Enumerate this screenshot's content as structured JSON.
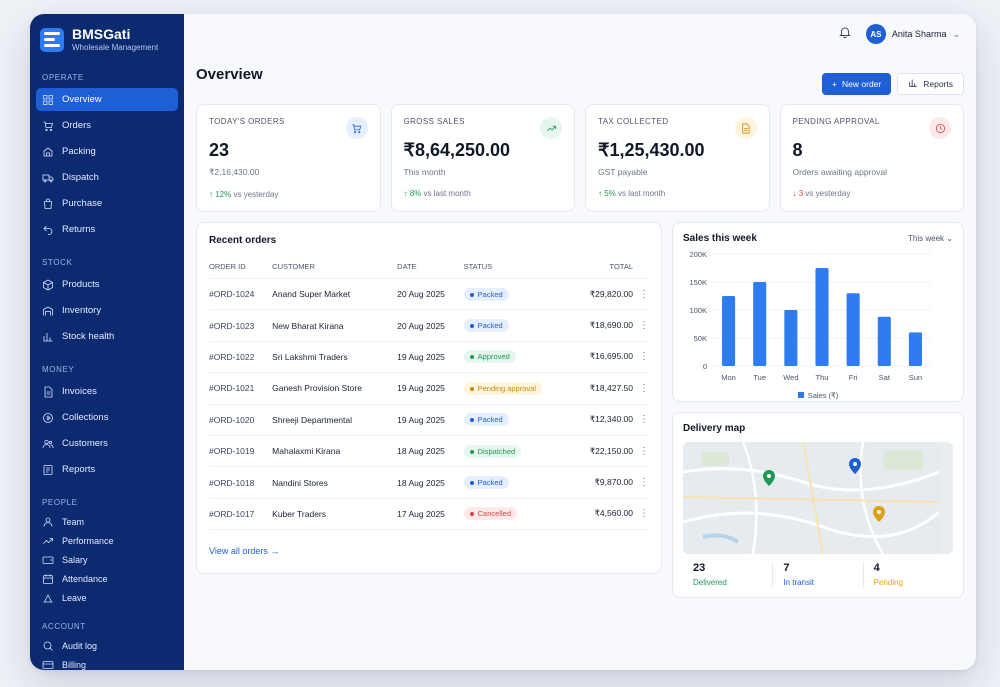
{
  "brand": {
    "name": "BMSGati",
    "subtitle": "Wholesale Management"
  },
  "sidebar": {
    "sections": [
      {
        "label": "OPERATE",
        "items": [
          {
            "label": "Overview",
            "icon": "grid-icon",
            "active": true
          },
          {
            "label": "Orders",
            "icon": "cart-icon"
          },
          {
            "label": "Packing",
            "icon": "box-icon"
          },
          {
            "label": "Dispatch",
            "icon": "truck-icon"
          },
          {
            "label": "Purchase",
            "icon": "bag-icon"
          },
          {
            "label": "Returns",
            "icon": "return-icon"
          }
        ]
      },
      {
        "label": "STOCK",
        "items": [
          {
            "label": "Products",
            "icon": "cube-icon"
          },
          {
            "label": "Inventory",
            "icon": "warehouse-icon"
          },
          {
            "label": "Stock health",
            "icon": "bar-chart-icon"
          }
        ]
      },
      {
        "label": "MONEY",
        "items": [
          {
            "label": "Invoices",
            "icon": "invoice-icon"
          },
          {
            "label": "Collections",
            "icon": "coin-icon"
          },
          {
            "label": "Customers",
            "icon": "users-icon"
          },
          {
            "label": "Reports",
            "icon": "report-icon"
          }
        ]
      },
      {
        "label": "PEOPLE",
        "items": [
          {
            "label": "Team",
            "icon": "user-icon"
          },
          {
            "label": "Performance",
            "icon": "trend-icon"
          },
          {
            "label": "Salary",
            "icon": "wallet-icon"
          },
          {
            "label": "Attendance",
            "icon": "calendar-icon"
          },
          {
            "label": "Leave",
            "icon": "leave-icon"
          }
        ]
      },
      {
        "label": "ACCOUNT",
        "items": [
          {
            "label": "Audit log",
            "icon": "search-icon"
          },
          {
            "label": "Billing",
            "icon": "card-icon"
          }
        ]
      }
    ]
  },
  "topbar": {
    "user_initials": "AS",
    "user_name": "Anita Sharma"
  },
  "page": {
    "title": "Overview",
    "new_order": "New order",
    "reports": "Reports"
  },
  "kpis": [
    {
      "label": "TODAY'S ORDERS",
      "value": "23",
      "sub": "₹2,16,430.00",
      "trend_arrow": "↑",
      "trend_value": "12%",
      "trend_text": "vs yesterday",
      "trend_dir": "up",
      "icon": "cart-icon",
      "color": "#1f5fd6",
      "bg": "#e6efff"
    },
    {
      "label": "GROSS SALES",
      "value": "₹8,64,250.00",
      "sub": "This month",
      "trend_arrow": "↑",
      "trend_value": "8%",
      "trend_text": "vs last month",
      "trend_dir": "up",
      "icon": "trend-up-icon",
      "color": "#1e9a55",
      "bg": "#e5f6ec"
    },
    {
      "label": "TAX COLLECTED",
      "value": "₹1,25,430.00",
      "sub": "GST payable",
      "trend_arrow": "↑",
      "trend_value": "5%",
      "trend_text": "vs last month",
      "trend_dir": "up",
      "icon": "document-icon",
      "color": "#c98a0a",
      "bg": "#fff4dc"
    },
    {
      "label": "PENDING APPROVAL",
      "value": "8",
      "sub": "Orders awaiting approval",
      "trend_arrow": "↓",
      "trend_value": "3",
      "trend_text": "vs yesterday",
      "trend_dir": "down",
      "icon": "clock-icon",
      "color": "#d64545",
      "bg": "#fde9e9"
    }
  ],
  "orders": {
    "title": "Recent orders",
    "columns": [
      "ORDER ID",
      "CUSTOMER",
      "DATE",
      "STATUS",
      "TOTAL"
    ],
    "rows": [
      {
        "id": "#ORD-1024",
        "customer": "Anand Super Market",
        "date": "20 Aug 2025",
        "status": "Packed",
        "kind": "packed",
        "total": "₹29,820.00"
      },
      {
        "id": "#ORD-1023",
        "customer": "New Bharat Kirana",
        "date": "20 Aug 2025",
        "status": "Packed",
        "kind": "packed",
        "total": "₹18,690.00"
      },
      {
        "id": "#ORD-1022",
        "customer": "Sri Lakshmi Traders",
        "date": "19 Aug 2025",
        "status": "Approved",
        "kind": "approved",
        "total": "₹16,695.00"
      },
      {
        "id": "#ORD-1021",
        "customer": "Ganesh Provision Store",
        "date": "19 Aug 2025",
        "status": "Pending approval",
        "kind": "pending",
        "total": "₹18,427.50"
      },
      {
        "id": "#ORD-1020",
        "customer": "Shreeji Departmental",
        "date": "19 Aug 2025",
        "status": "Packed",
        "kind": "packed",
        "total": "₹12,340.00"
      },
      {
        "id": "#ORD-1019",
        "customer": "Mahalaxmi Kirana",
        "date": "18 Aug 2025",
        "status": "Dispatched",
        "kind": "dispatched",
        "total": "₹22,150.00"
      },
      {
        "id": "#ORD-1018",
        "customer": "Nandini Stores",
        "date": "18 Aug 2025",
        "status": "Packed",
        "kind": "packed",
        "total": "₹9,870.00"
      },
      {
        "id": "#ORD-1017",
        "customer": "Kuber Traders",
        "date": "17 Aug 2025",
        "status": "Cancelled",
        "kind": "cancelled",
        "total": "₹4,560.00"
      }
    ],
    "view_all": "View all orders →"
  },
  "sales": {
    "title": "Sales this week",
    "range": "This week"
  },
  "chart_data": {
    "type": "bar",
    "categories": [
      "Mon",
      "Tue",
      "Wed",
      "Thu",
      "Fri",
      "Sat",
      "Sun"
    ],
    "series": [
      {
        "name": "Sales (₹)",
        "values": [
          125000,
          150000,
          100000,
          175000,
          130000,
          88000,
          60000
        ]
      }
    ],
    "ylim": [
      0,
      200000
    ],
    "yticks": [
      "0",
      "50K",
      "100K",
      "150K",
      "200K"
    ],
    "color": "#2e7cf0",
    "legend": "bottom"
  },
  "delivery": {
    "title": "Delivery map",
    "stats": [
      {
        "value": "23",
        "label": "Delivered",
        "color": "#1e9a55"
      },
      {
        "value": "7",
        "label": "In transit",
        "color": "#1f5fd6"
      },
      {
        "value": "4",
        "label": "Pending",
        "color": "#e0a015"
      }
    ]
  }
}
